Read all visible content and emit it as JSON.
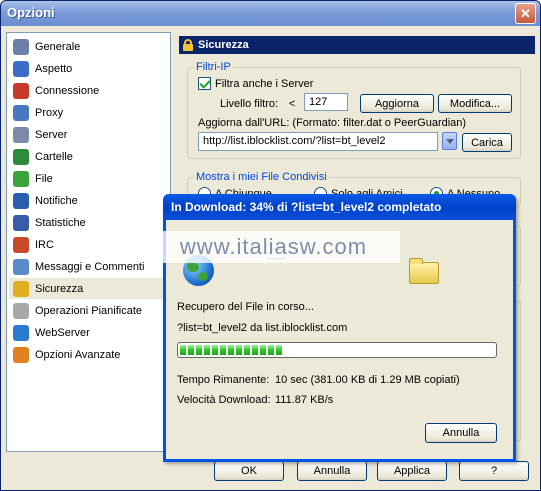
{
  "window": {
    "title": "Opzioni",
    "close_glyph": "✕"
  },
  "sidebar": {
    "items": [
      {
        "label": "Generale",
        "icon": "gear-icon",
        "color": "#6c7fa8"
      },
      {
        "label": "Aspetto",
        "icon": "paint-icon",
        "color": "#3a6cc8"
      },
      {
        "label": "Connessione",
        "icon": "plug-icon",
        "color": "#c83a2a"
      },
      {
        "label": "Proxy",
        "icon": "proxy-icon",
        "color": "#4a78c0"
      },
      {
        "label": "Server",
        "icon": "server-icon",
        "color": "#7a8aa8"
      },
      {
        "label": "Cartelle",
        "icon": "folder-icon",
        "color": "#2e8b3a"
      },
      {
        "label": "File",
        "icon": "file-icon",
        "color": "#3aa33a"
      },
      {
        "label": "Notifiche",
        "icon": "notification-icon",
        "color": "#2a5fb0"
      },
      {
        "label": "Statistiche",
        "icon": "chart-icon",
        "color": "#3a5ca8"
      },
      {
        "label": "IRC",
        "icon": "irc-icon",
        "color": "#c84a2a"
      },
      {
        "label": "Messaggi e Commenti",
        "icon": "message-icon",
        "color": "#5a8ac8"
      },
      {
        "label": "Sicurezza",
        "icon": "lock-icon",
        "color": "#e0b020"
      },
      {
        "label": "Operazioni Pianificate",
        "icon": "calendar-icon",
        "color": "#a8a8a8"
      },
      {
        "label": "WebServer",
        "icon": "globe-icon",
        "color": "#2a7ad0"
      },
      {
        "label": "Opzioni Avanzate",
        "icon": "advanced-icon",
        "color": "#e08020"
      }
    ],
    "selected_index": 11
  },
  "panel": {
    "header": "Sicurezza",
    "ip_filter": {
      "group_title": "Filtri-IP",
      "checkbox_label": "Filtra anche i Server",
      "checked": true,
      "level_label": "Livello filtro:",
      "level_op": "<",
      "level_value": "127",
      "update_button": "Aggiorna",
      "modify_button": "Modifica...",
      "url_label": "Aggiorna dall'URL: (Formato: filter.dat o PeerGuardian)",
      "url_value": "http://list.iblocklist.com/?list=bt_level2",
      "load_button": "Carica"
    },
    "shared_files": {
      "group_title": "Mostra i miei File Condivisi",
      "options": [
        "A Chiunque",
        "Solo agli Amici",
        "A Nessuno"
      ],
      "selected": 2
    }
  },
  "footer": {
    "ok": "OK",
    "cancel": "Annulla",
    "apply": "Applica",
    "help": "?"
  },
  "download_dialog": {
    "title": "In Download: 34% di ?list=bt_level2 completato",
    "status": "Recupero del File in corso...",
    "source": "?list=bt_level2 da list.iblocklist.com",
    "progress_fraction": 0.34,
    "time_label": "Tempo Rimanente:",
    "time_value": "10 sec (381.00 KB di 1.29 MB copiati)",
    "speed_label": "Velocità Download:",
    "speed_value": "111.87 KB/s",
    "cancel_button": "Annulla"
  },
  "watermark": "www.italiasw.com"
}
